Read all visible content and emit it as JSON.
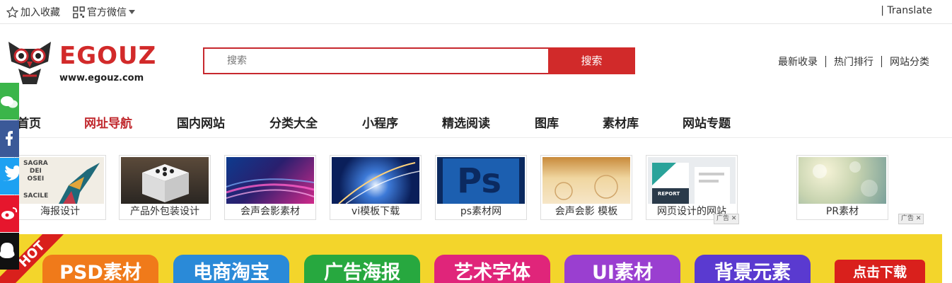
{
  "topbar": {
    "favorite_label": "加入收藏",
    "wechat_label": "官方微信",
    "translate_label": "| Translate"
  },
  "logo": {
    "name": "EGOUZ",
    "url": "www.egouz.com"
  },
  "search": {
    "placeholder": "搜索",
    "button_label": "搜索"
  },
  "right_links": [
    "最新收录",
    "热门排行",
    "网站分类"
  ],
  "nav": {
    "items": [
      "首页",
      "网址导航",
      "国内网站",
      "分类大全",
      "小程序",
      "精选阅读",
      "图库",
      "素材库",
      "网站专题"
    ],
    "active": "网址导航"
  },
  "tiles": [
    {
      "caption": "海报设计",
      "image_text": [
        "SAGRA",
        "DEI",
        "OSEI",
        "SACILE"
      ]
    },
    {
      "caption": "产品外包装设计"
    },
    {
      "caption": "会声会影素材"
    },
    {
      "caption": "vi模板下载"
    },
    {
      "caption": "ps素材网",
      "image_text": "Ps"
    },
    {
      "caption": "会声会影 模板"
    },
    {
      "caption": "网页设计的网站",
      "image_text": "REPORT"
    },
    {
      "caption": "PR素材"
    }
  ],
  "ad_label": "广告",
  "hot_banner": {
    "hot_label": "HOT",
    "categories": [
      {
        "label": "PSD素材",
        "color": "#f07a1a"
      },
      {
        "label": "电商淘宝",
        "color": "#2a8ad8"
      },
      {
        "label": "广告海报",
        "color": "#27a83f"
      },
      {
        "label": "艺术字体",
        "color": "#e0257a"
      },
      {
        "label": "UI素材",
        "color": "#9a3fd0"
      },
      {
        "label": "背景元素",
        "color": "#5a3ad0"
      }
    ],
    "download_label": "点击下载"
  },
  "colors": {
    "accent": "#c7282e",
    "banner": "#f3d52b"
  },
  "social_icons": [
    "wechat-icon",
    "facebook-icon",
    "twitter-icon",
    "weibo-icon",
    "qq-icon"
  ]
}
